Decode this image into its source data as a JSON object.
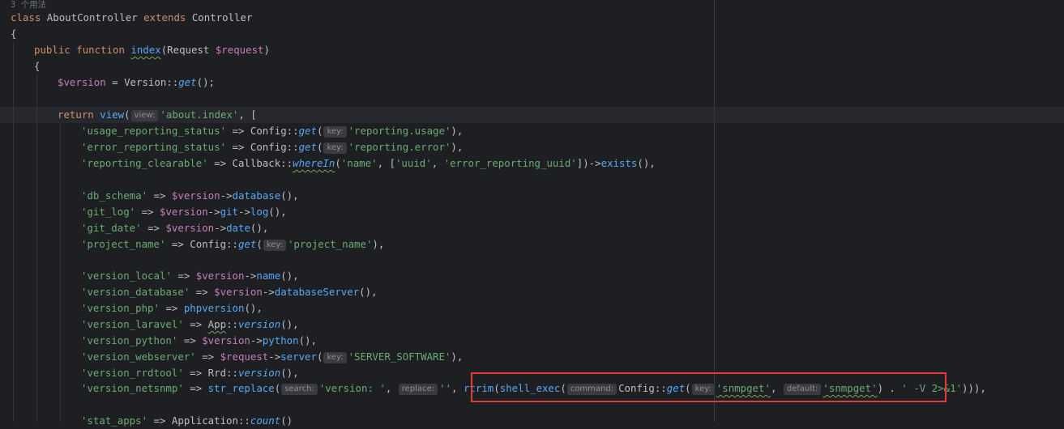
{
  "editor": {
    "usages_hint": "3 个用法",
    "hints": {
      "view": "view:",
      "key": "key:",
      "search": "search:",
      "replace": "replace:",
      "command": "command:",
      "default": "default:"
    },
    "code": {
      "class_kw": "class",
      "class_name": " AboutController ",
      "extends_kw": "extends",
      "parent_class": " Controller",
      "open_brace": "{",
      "public_kw": "public",
      "function_kw": "function",
      "method_name": "index",
      "method_params_a": "(Request ",
      "request_var": "$request",
      "method_params_b": ")",
      "inner_brace": "{",
      "version_var": "$version",
      "assign_version": " = Version::",
      "get": "get",
      "call_end": "();",
      "return_kw": "return",
      "view_fn": "view",
      "paren_open": "(",
      "view_name": "'about.index'",
      "array_open": ", [",
      "k_usage": "'usage_reporting_status'",
      "k_error": "'error_reporting_status'",
      "k_clearable": "'reporting_clearable'",
      "k_db_schema": "'db_schema'",
      "k_git_log": "'git_log'",
      "k_git_date": "'git_date'",
      "k_project_name": "'project_name'",
      "k_version_local": "'version_local'",
      "k_version_database": "'version_database'",
      "k_version_php": "'version_php'",
      "k_version_laravel": "'version_laravel'",
      "k_version_python": "'version_python'",
      "k_version_webserver": "'version_webserver'",
      "k_version_rrdtool": "'version_rrdtool'",
      "k_version_netsnmp": "'version_netsnmp'",
      "k_stat_apps": "'stat_apps'",
      "arrow": " => ",
      "config": "Config::",
      "callback": "Callback::",
      "where_in": "whereIn",
      "v_reporting_usage": "'reporting.usage'",
      "v_reporting_error": "'reporting.error'",
      "close_comma": "),",
      "empty_call_comma": "(),",
      "where_in_args_a": "(",
      "where_in_name": "'name'",
      "where_in_args_b": ", [",
      "where_in_uuid": "'uuid'",
      "comma_sp": ", ",
      "where_in_err_uuid": "'error_reporting_uuid'",
      "where_in_args_c": "])->",
      "exists": "exists",
      "arrow_op": "->",
      "database": "database",
      "git": "git",
      "log": "log",
      "date": "date",
      "v_project_name": "'project_name'",
      "name": "name",
      "database_server": "databaseServer",
      "phpversion": "phpversion",
      "app": "App",
      "double_colon": "::",
      "version_fn": "version",
      "python": "python",
      "server": "server",
      "v_server_software": "'SERVER_SOFTWARE'",
      "rrd": "Rrd::",
      "str_replace": "str_replace",
      "v_version_prefix": "'version: '",
      "v_empty": "''",
      "rtrim": "rtrim",
      "shell_exec": "shell_exec",
      "snmpget_q": "'snmpget'",
      "concat": ") . ",
      "v_flag": "' -V 2>&1'",
      "tail": "))),",
      "application": "Application::",
      "count": "count",
      "stat_tail": "()"
    }
  }
}
